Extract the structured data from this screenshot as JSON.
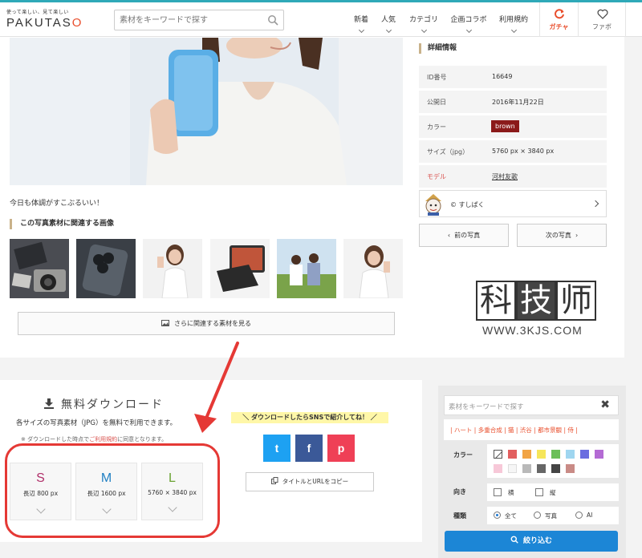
{
  "header": {
    "logo_tagline": "使って楽しい、見て楽しい",
    "logo_text_a": "PAKUTAS",
    "logo_text_b": "O",
    "search_placeholder": "素材をキーワードで探す",
    "nav": [
      "新着",
      "人気",
      "カテゴリ",
      "企画コラボ",
      "利用規約"
    ],
    "gacha_label": "ガチャ",
    "favorites_label": "ファボ"
  },
  "photo": {
    "caption": "今日も体調がすこぶるいい！"
  },
  "related": {
    "heading": "この写真素材に関連する画像",
    "more_button": "さらに関連する素材を見る"
  },
  "details": {
    "heading": "詳細情報",
    "rows": [
      {
        "key": "ID番号",
        "value": "16649"
      },
      {
        "key": "公開日",
        "value": "2016年11月22日"
      },
      {
        "key": "カラー",
        "value": "brown"
      },
      {
        "key": "サイズ（jpg）",
        "value": "5760 px × 3840 px"
      },
      {
        "key": "モデル",
        "value": "河村友歌"
      }
    ],
    "credit": "© すしぱく",
    "prev_button": "前の写真",
    "next_button": "次の写真"
  },
  "watermark": {
    "chars": [
      "科",
      "技",
      "师"
    ],
    "url": "WWW.3KJS.COM"
  },
  "download": {
    "title": "無料ダウンロード",
    "subtitle": "各サイズの写真素材（JPG）を無料で利用できます。",
    "note_prefix": "※ ダウンロードした時点で",
    "note_link": "ご利用規約",
    "note_suffix": "に同意となります。",
    "sizes": [
      {
        "letter": "S",
        "dim": "長辺 800 px",
        "color": "#b0306a"
      },
      {
        "letter": "M",
        "dim": "長辺 1600 px",
        "color": "#1f7fc3"
      },
      {
        "letter": "L",
        "dim": "5760 × 3840 px",
        "color": "#6aa232"
      }
    ]
  },
  "sns": {
    "banner": "＼ ダウンロードしたらSNSで紹介してね！ ／",
    "twitter_glyph": "t",
    "facebook_glyph": "f",
    "pocket_glyph": "p",
    "copy_button": "タイトルとURLをコピー"
  },
  "filter": {
    "search_placeholder": "素材をキーワードで探す",
    "tags": "| ハート | 多重合成 | 猫 | 渋谷 | 都市景観 | 侍 |",
    "color_label": "カラー",
    "orientation_label": "向き",
    "orientation_options": [
      "横",
      "縦"
    ],
    "type_label": "種類",
    "type_options": [
      "全て",
      "写真",
      "AI"
    ],
    "submit_label": "絞り込む",
    "swatches": [
      "#ffffff",
      "#e25f5f",
      "#f2a444",
      "#f6e65a",
      "#6bbf59",
      "#9fd6f0",
      "#6a6de0",
      "#b46bd4",
      "#f7c8d8",
      "#f6f6f6",
      "#b9b9b9",
      "#666666",
      "#444444",
      "#c98b86"
    ]
  }
}
